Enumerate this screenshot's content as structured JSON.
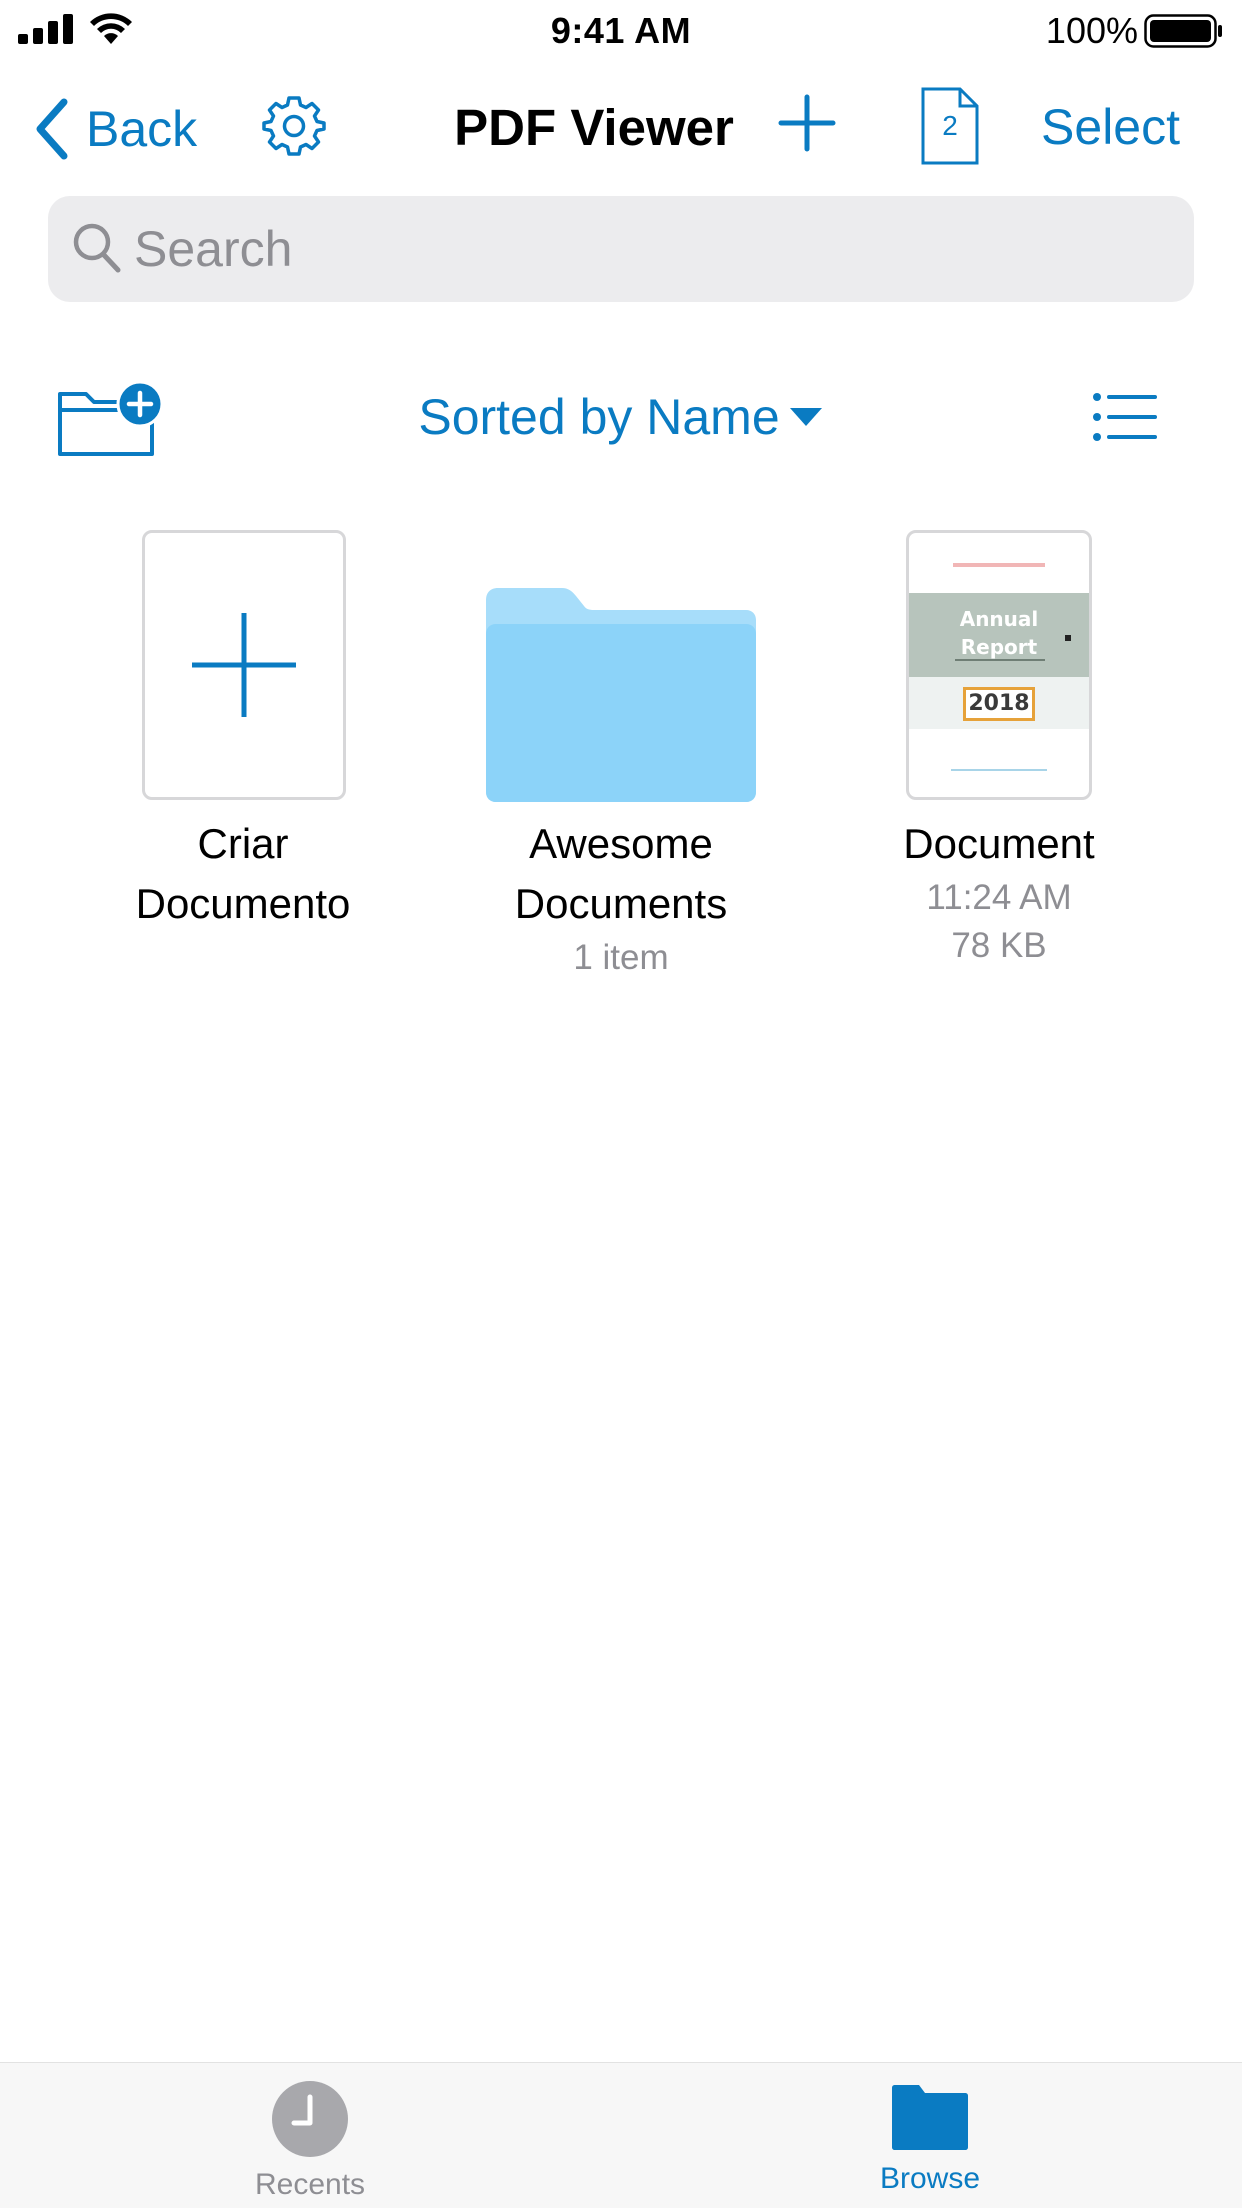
{
  "status_bar": {
    "time": "9:41 AM",
    "battery_percent": "100%"
  },
  "nav": {
    "back_label": "Back",
    "title": "PDF Viewer",
    "pages_count": "2",
    "select_label": "Select"
  },
  "search": {
    "placeholder": "Search"
  },
  "toolbar": {
    "sort_label": "Sorted by Name"
  },
  "items": [
    {
      "name_line1": "Criar",
      "name_line2": "Documento",
      "type": "create"
    },
    {
      "name_line1": "Awesome",
      "name_line2": "Documents",
      "meta": "1 item",
      "type": "folder"
    },
    {
      "name": "Document",
      "time": "11:24 AM",
      "size": "78 KB",
      "type": "pdf",
      "thumbnail": {
        "title_line1": "Annual",
        "title_line2": "Report",
        "year": "2018"
      }
    }
  ],
  "tabs": [
    {
      "label": "Recents",
      "icon": "clock-icon",
      "active": false
    },
    {
      "label": "Browse",
      "icon": "folder-icon",
      "active": true
    }
  ],
  "colors": {
    "accent": "#0a7bc2",
    "folder": "#8fd3f8",
    "secondary_text": "#8e8e93",
    "search_bg": "#ececee"
  }
}
